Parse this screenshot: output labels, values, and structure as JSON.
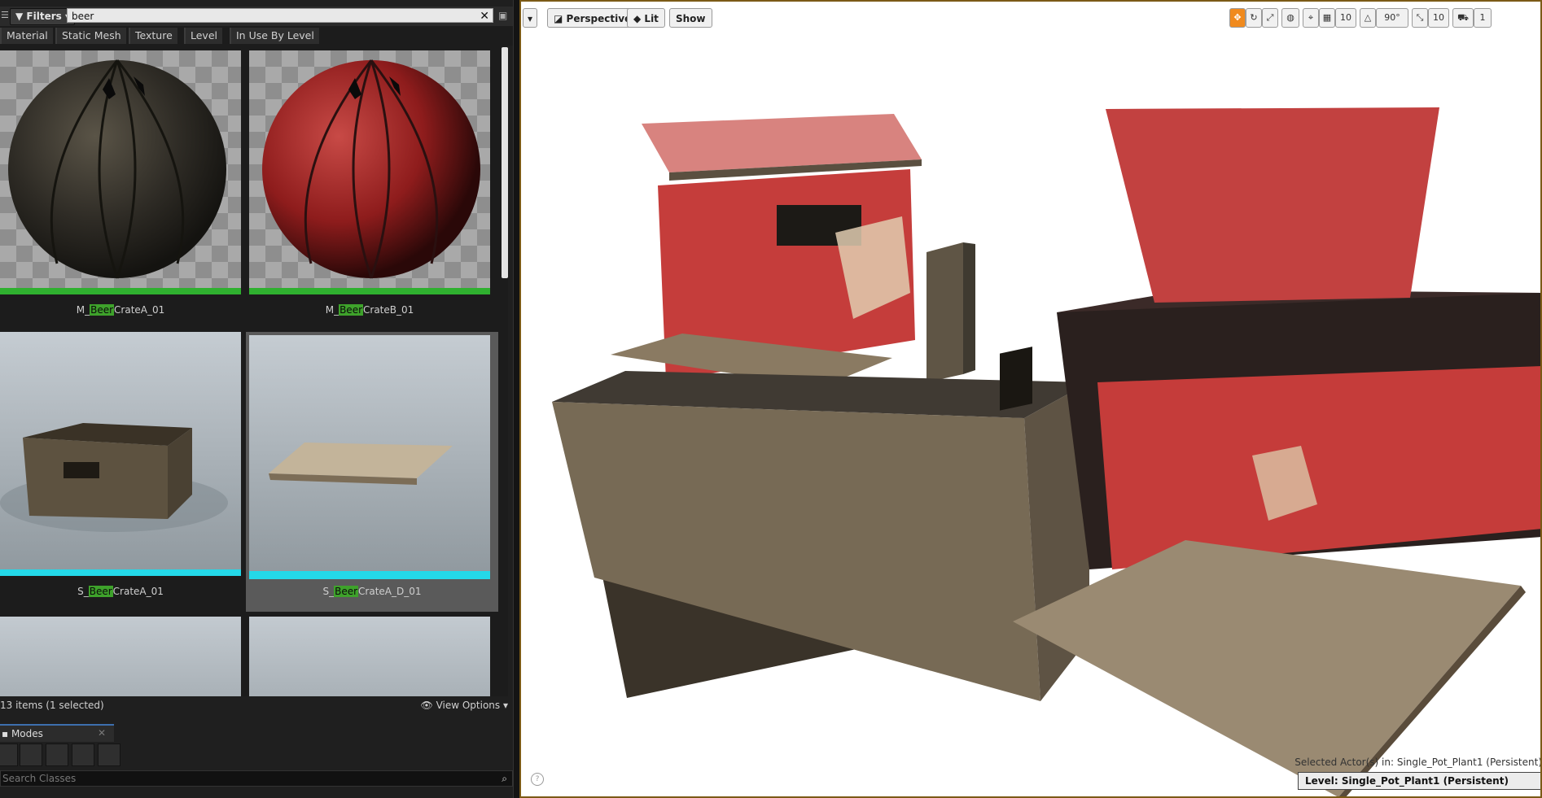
{
  "content_browser": {
    "filters_label": "Filters",
    "search_value": "beer",
    "filter_tabs": [
      "Material",
      "Static Mesh",
      "Texture",
      "Level",
      "In Use By Level"
    ],
    "assets": [
      {
        "pre": "M_",
        "hl": "Beer",
        "post": "CrateA_01",
        "type": "material",
        "selected": false
      },
      {
        "pre": "M_",
        "hl": "Beer",
        "post": "CrateB_01",
        "type": "material",
        "selected": false
      },
      {
        "pre": "S_",
        "hl": "Beer",
        "post": "CrateA_01",
        "type": "static-mesh",
        "selected": false
      },
      {
        "pre": "S_",
        "hl": "Beer",
        "post": "CrateA_D_01",
        "type": "static-mesh",
        "selected": true
      }
    ],
    "item_count": "13 items (1 selected)",
    "view_options": "View Options"
  },
  "modes": {
    "title": "Modes",
    "tool_icons": [
      "place-icon",
      "paint-icon",
      "landscape-icon",
      "foliage-icon",
      "geometry-icon"
    ],
    "search_placeholder": "Search Classes"
  },
  "viewport": {
    "perspective": "Perspective",
    "lit": "Lit",
    "show": "Show",
    "grid_snap": "10",
    "rotation_snap": "90°",
    "scale_snap": "10",
    "camera_speed": "1",
    "selected_info": "Selected Actor(s) in:  Single_Pot_Plant1 (Persistent)",
    "level_info": "Level:  Single_Pot_Plant1 (Persistent)"
  },
  "colors": {
    "material_bar": "#2fb02f",
    "mesh_bar": "#24d8e8",
    "accent": "#f08a1e"
  }
}
